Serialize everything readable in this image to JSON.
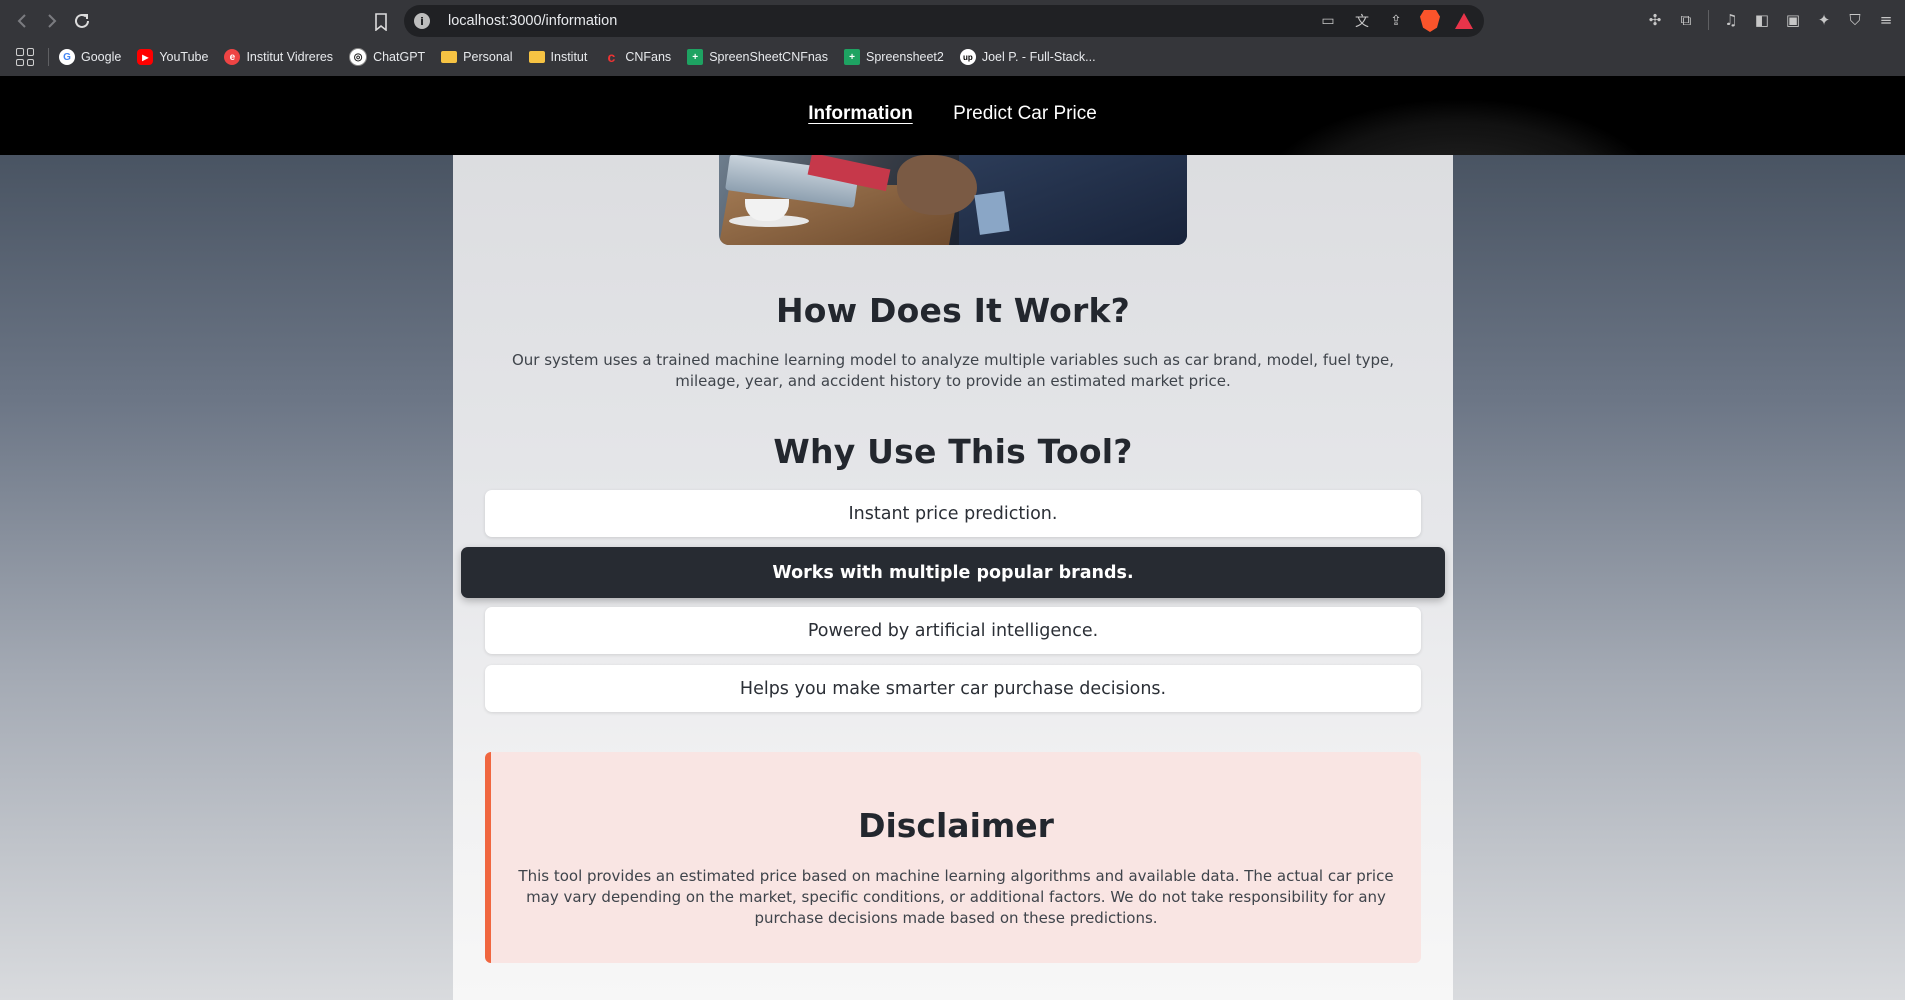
{
  "browser": {
    "url": "localhost:3000/information",
    "bookmarks": [
      {
        "label": "Google",
        "icon": "google-icon"
      },
      {
        "label": "YouTube",
        "icon": "youtube-icon"
      },
      {
        "label": "Institut Vidreres",
        "icon": "institut-vidreres-icon"
      },
      {
        "label": "ChatGPT",
        "icon": "chatgpt-icon"
      },
      {
        "label": "Personal",
        "icon": "folder-icon"
      },
      {
        "label": "Institut",
        "icon": "folder-icon"
      },
      {
        "label": "CNFans",
        "icon": "cnfans-icon"
      },
      {
        "label": "SpreenSheetCNFnas",
        "icon": "sheets-icon"
      },
      {
        "label": "Spreensheet2",
        "icon": "sheets-icon"
      },
      {
        "label": "Joel P. - Full-Stack...",
        "icon": "upwork-icon"
      }
    ]
  },
  "nav": {
    "links": [
      {
        "label": "Information",
        "active": true
      },
      {
        "label": "Predict Car Price",
        "active": false
      }
    ]
  },
  "how": {
    "title": "How Does It Work?",
    "text": "Our system uses a trained machine learning model to analyze multiple variables such as car brand, model, fuel type, mileage, year, and accident history to provide an estimated market price."
  },
  "why": {
    "title": "Why Use This Tool?",
    "features": [
      "Instant price prediction.",
      "Works with multiple popular brands.",
      "Powered by artificial intelligence.",
      "Helps you make smarter car purchase decisions."
    ]
  },
  "disclaimer": {
    "title": "Disclaimer",
    "text": "This tool provides an estimated price based on machine learning algorithms and available data. The actual car price may vary depending on the market, specific conditions, or additional factors. We do not take responsibility for any purchase decisions made based on these predictions."
  },
  "colors": {
    "nav_bg": "#000000",
    "highlight_feature_bg": "#272b32",
    "disclaimer_bg": "#f9e5e3",
    "disclaimer_accent": "#f0663f"
  }
}
